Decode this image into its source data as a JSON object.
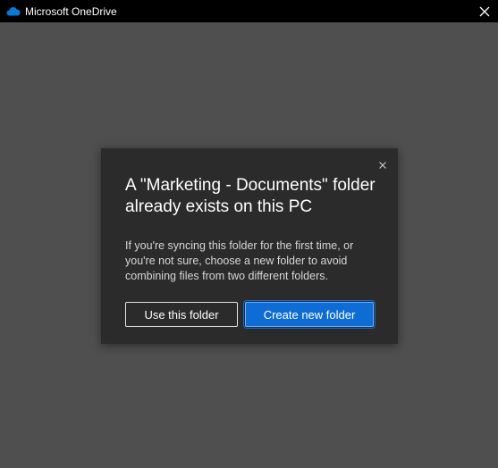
{
  "window": {
    "title": "Microsoft OneDrive",
    "icon": "onedrive-cloud-icon",
    "close_icon": "close-icon"
  },
  "dialog": {
    "heading": "A \"Marketing - Documents\" folder already exists on this PC",
    "body": "If you're syncing this folder for the first time, or you're not sure, choose a new folder to avoid combining files from two different folders.",
    "close_icon": "close-icon",
    "buttons": {
      "use_folder": "Use this folder",
      "create_folder": "Create new folder"
    }
  },
  "colors": {
    "titlebar": "#000000",
    "backdrop": "#4f4f4f",
    "dialog_bg": "#2b2b2b",
    "primary_button": "#0f6cd4",
    "onedrive_blue": "#0a78d7"
  }
}
